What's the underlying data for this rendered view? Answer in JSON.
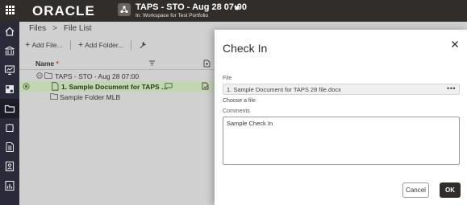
{
  "topbar": {
    "brand": "ORACLE",
    "workspace_title": "TAPS - STO - Aug 28 07:00",
    "workspace_subtitle": "In: Workspace for Test Portfolio"
  },
  "leftnav": {
    "items": [
      "home-icon",
      "bank-icon",
      "monitor-chart-icon",
      "grid-icon",
      "folder-icon",
      "puzzle-icon",
      "document-icon",
      "contact-card-icon",
      "report-chart-icon"
    ],
    "active": "folder-icon"
  },
  "main": {
    "breadcrumb": [
      "Files",
      "File List"
    ],
    "breadcrumb_separator": ">",
    "toolbar": {
      "add_file": "Add File...",
      "add_folder": "Add Folder..."
    },
    "grid": {
      "name_header": "Name",
      "required_mark": "*",
      "rows": [
        {
          "label": "TAPS - STO - Aug 28 07:00",
          "type": "folder-open"
        },
        {
          "label": "1. Sample Document for TAPS ...",
          "type": "document",
          "selected": true
        },
        {
          "label": "Sample Folder MLB",
          "type": "folder"
        }
      ]
    }
  },
  "dialog": {
    "title": "Check In",
    "file_label": "File",
    "file_value": "1. Sample Document for TAPS 28 file.docx",
    "choose_file": "Choose a file",
    "comments_label": "Comments",
    "comments_value": "Sample Check In",
    "cancel_label": "Cancel",
    "ok_label": "OK"
  },
  "colors": {
    "topbar": "#312d2a",
    "leftnav": "#2b2a3a",
    "selected_row": "#c3d6b3",
    "ok_button": "#312d2a"
  }
}
